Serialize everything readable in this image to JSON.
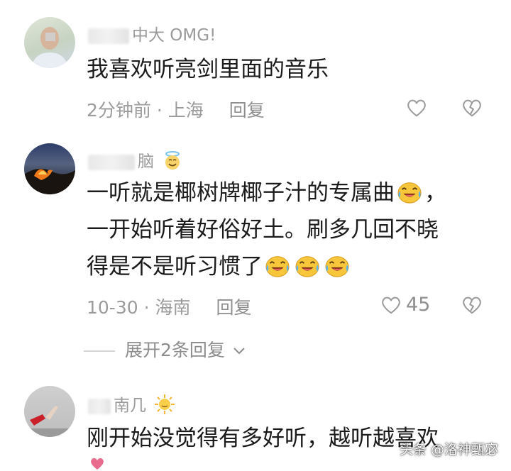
{
  "comments": [
    {
      "username": "中大  OMG!",
      "text_lines": [
        "我喜欢听亮剑里面的音乐"
      ],
      "time": "2分钟前",
      "location": "上海",
      "reply_label": "回复",
      "like_count": ""
    },
    {
      "username": "脑",
      "text_lines": [
        "一听就是椰树牌椰子汁的专属曲",
        "，",
        "一开始听着好俗好土。刷多几回不晓",
        "得是不是听习惯了"
      ],
      "time": "10-30",
      "location": "海南",
      "reply_label": "回复",
      "like_count": "45"
    },
    {
      "username": "南几",
      "text_lines": [
        "刚开始没觉得有多好听，越听越喜欢"
      ],
      "time": "",
      "location": "",
      "reply_label": "",
      "like_count": ""
    }
  ],
  "expand_replies": "展开2条回复",
  "separator": "·",
  "watermark": "头条 @洛神甄宓",
  "icons": {
    "like": "heart-outline-icon",
    "dislike": "broken-heart-icon",
    "emoji": "crying-laughing-emoji",
    "badge_angel": "angel-face-icon",
    "badge_sun": "sun-icon",
    "chevron": "chevron-down-icon"
  },
  "colors": {
    "meta_gray": "#9b9b9b",
    "text": "#1b1b1b",
    "emoji_yellow": "#f7c63b"
  }
}
